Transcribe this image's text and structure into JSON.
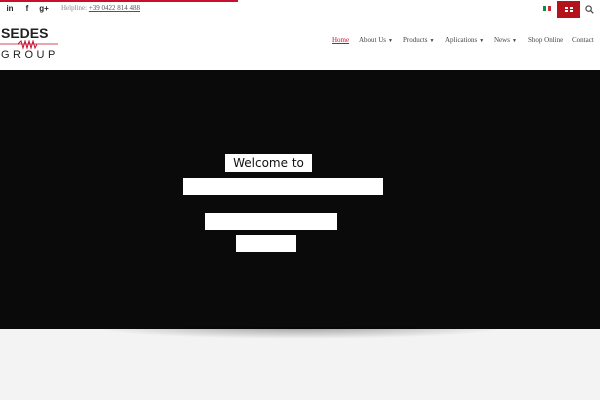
{
  "topbar": {
    "social": [
      {
        "name": "linkedin-icon",
        "glyph": "in"
      },
      {
        "name": "facebook-icon",
        "glyph": "f"
      },
      {
        "name": "google-plus-icon",
        "glyph": "g+"
      }
    ],
    "helpline_label": "Helpline:",
    "helpline_phone": "+39 0422 814 488"
  },
  "logo": {
    "line1": "SEDES",
    "line2": "GROUP"
  },
  "nav": {
    "home": "Home",
    "about": "About Us",
    "products": "Products",
    "applications": "Aplications",
    "news": "News",
    "shop": "Shop Online",
    "contact": "Contact",
    "caret": "▼"
  },
  "hero": {
    "welcome": "Welcome to"
  },
  "colors": {
    "accent": "#c8102e",
    "hero_bg": "#0a0a0a",
    "lang_active": "#b5121b"
  }
}
